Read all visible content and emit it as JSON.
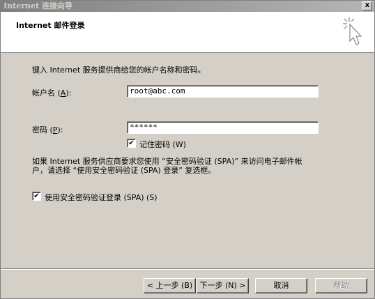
{
  "window": {
    "title": "Internet 连接向导",
    "close_glyph": "x"
  },
  "header": {
    "title": "Internet 邮件登录",
    "icon": "wizard-wand-icon"
  },
  "content": {
    "intro": "键入 Internet 服务提供商给您的帐户名称和密码。",
    "account_label_prefix": "帐户名 (",
    "account_label_key": "A",
    "account_label_suffix": "):",
    "account_value": "root@abc.com",
    "password_label_prefix": "密码 (",
    "password_label_key": "P",
    "password_label_suffix": "):",
    "password_value": "******",
    "remember_label": "记住密码 (W)",
    "remember_checked": true,
    "spa_info": "如果 Internet 服务供应商要求您使用 “安全密码验证 (SPA)” 来访问电子邮件帐户，请选择 “使用安全密码验证 (SPA) 登录” 复选框。",
    "spa_label": "使用安全密码验证登录 (SPA) (S)",
    "spa_checked": true
  },
  "buttons": {
    "back": "< 上一步 (B)",
    "next": "下一步 (N) >",
    "cancel": "取消",
    "help": "帮助"
  },
  "check_glyph": "✔"
}
